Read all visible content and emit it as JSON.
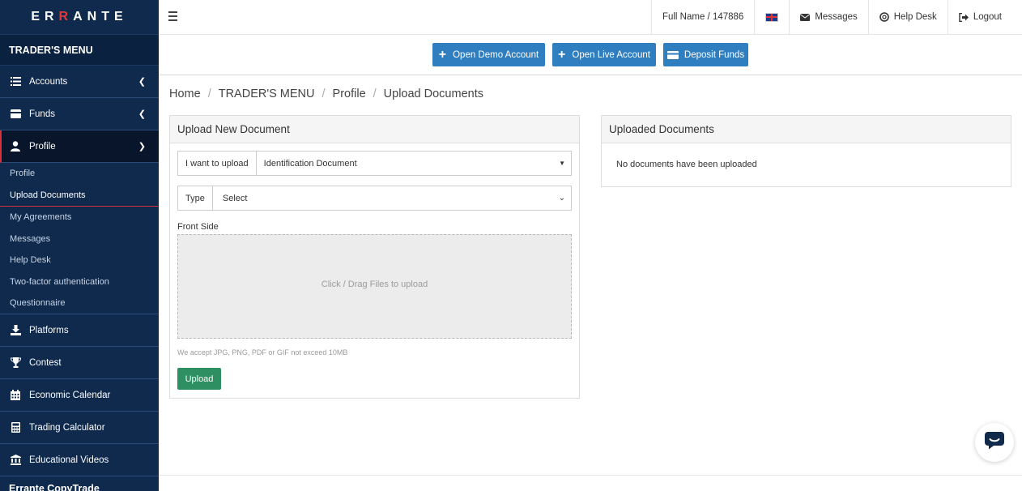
{
  "brand": {
    "logo_pre": "ER",
    "logo_x": "R",
    "logo_post": "ANTE"
  },
  "sidebar": {
    "menu_title": "TRADER'S MENU",
    "items": [
      {
        "label": "Accounts",
        "icon": "list-icon"
      },
      {
        "label": "Funds",
        "icon": "wallet-icon"
      },
      {
        "label": "Profile",
        "icon": "user-icon"
      }
    ],
    "profile_sub": [
      "Profile",
      "Upload Documents",
      "My Agreements",
      "Messages",
      "Help Desk",
      "Two-factor authentication",
      "Questionnaire"
    ],
    "lower_items": [
      {
        "label": "Platforms",
        "icon": "download-icon"
      },
      {
        "label": "Contest",
        "icon": "trophy-icon"
      },
      {
        "label": "Economic Calendar",
        "icon": "calendar-icon"
      },
      {
        "label": "Trading Calculator",
        "icon": "calculator-icon"
      },
      {
        "label": "Educational Videos",
        "icon": "institution-icon"
      }
    ],
    "cut_item": "Errante CopyTrade"
  },
  "topbar": {
    "user": "Full Name / 147886",
    "messages": "Messages",
    "help_desk": "Help Desk",
    "logout": "Logout"
  },
  "actions": {
    "demo": "Open Demo Account",
    "live": "Open Live Account",
    "deposit": "Deposit Funds"
  },
  "breadcrumb": [
    "Home",
    "TRADER'S MENU",
    "Profile",
    "Upload Documents"
  ],
  "upload_panel": {
    "title": "Upload New Document",
    "upload_label": "I want to upload",
    "upload_value": "Identification Document",
    "type_label": "Type",
    "type_value": "Select",
    "front_side": "Front Side",
    "drop_text": "Click / Drag Files to upload",
    "note": "We accept JPG, PNG, PDF or GIF not exceed 10MB",
    "button": "Upload"
  },
  "uploaded_panel": {
    "title": "Uploaded Documents",
    "empty": "No documents have been uploaded"
  },
  "colors": {
    "sidebar": "#0f2a4d",
    "accent_red": "#d6303a",
    "primary": "#2f7ec0",
    "success": "#2e9062"
  }
}
